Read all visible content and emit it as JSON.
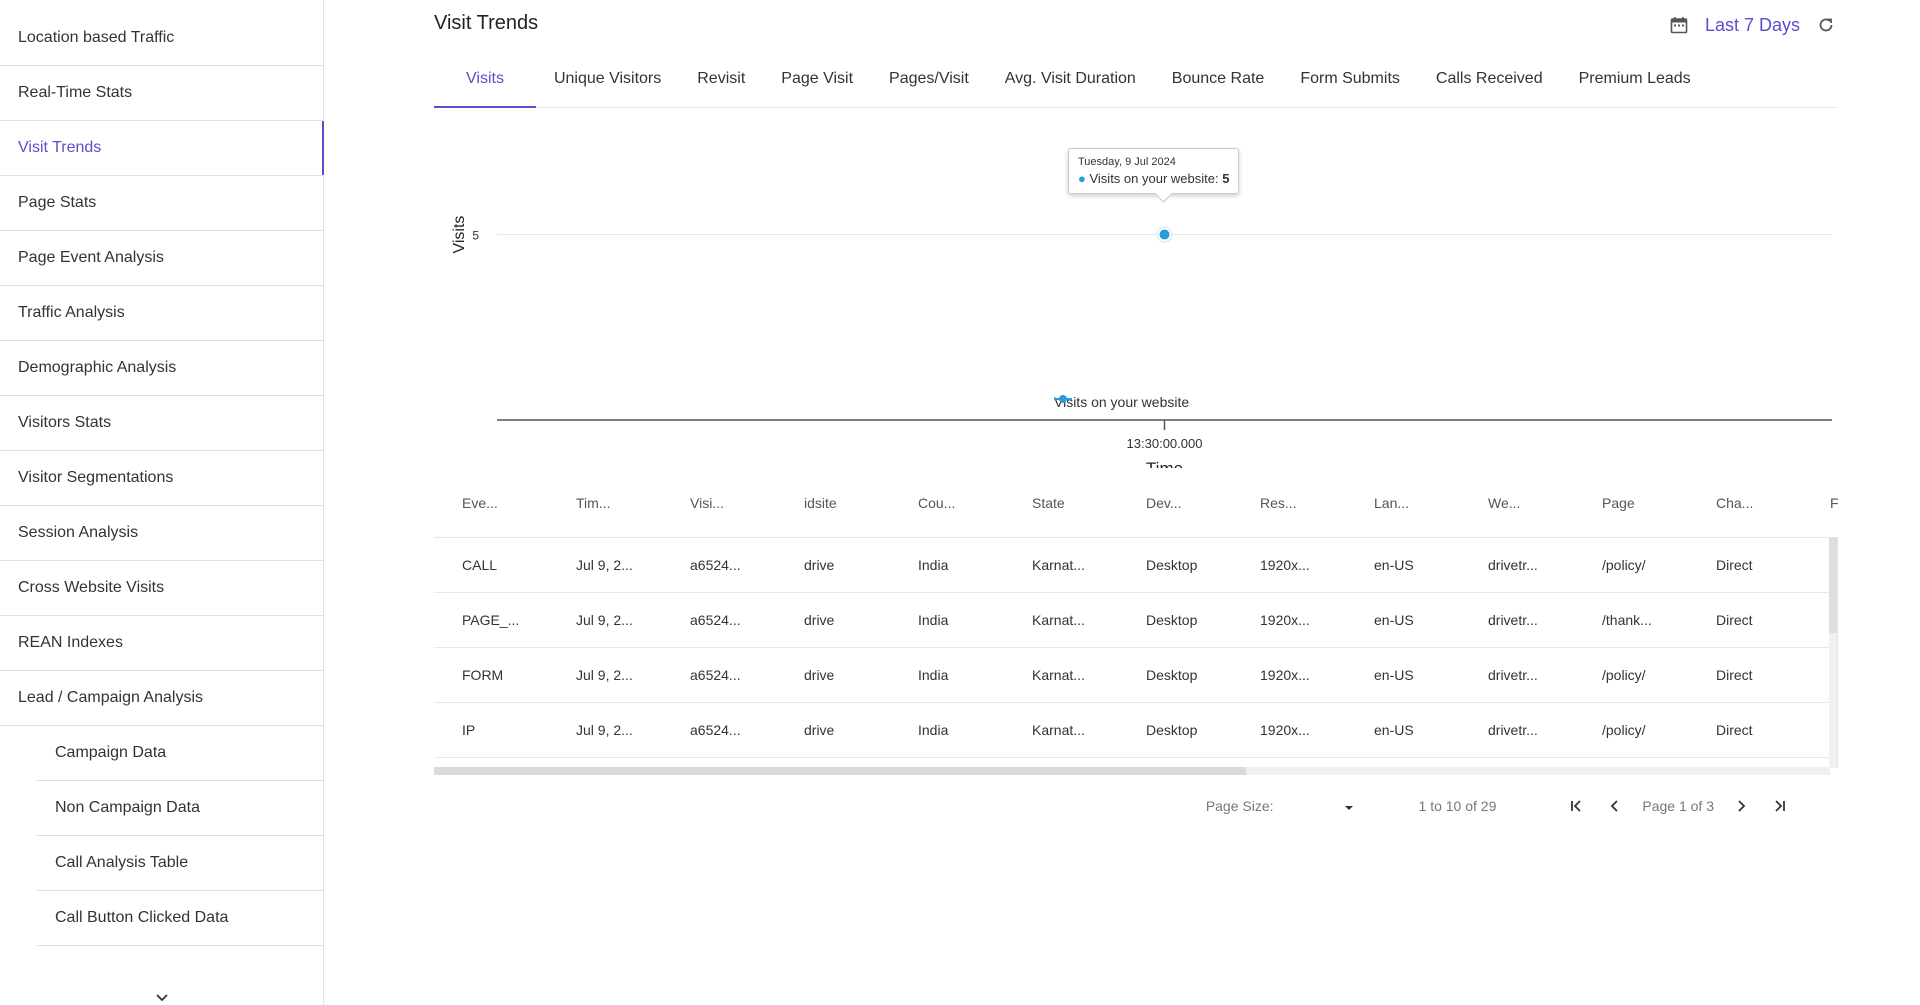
{
  "sidebar": {
    "items": [
      {
        "label": "Location based Traffic",
        "active": false,
        "sub": false
      },
      {
        "label": "Real-Time Stats",
        "active": false,
        "sub": false
      },
      {
        "label": "Visit Trends",
        "active": true,
        "sub": false
      },
      {
        "label": "Page Stats",
        "active": false,
        "sub": false
      },
      {
        "label": "Page Event Analysis",
        "active": false,
        "sub": false
      },
      {
        "label": "Traffic Analysis",
        "active": false,
        "sub": false
      },
      {
        "label": "Demographic Analysis",
        "active": false,
        "sub": false
      },
      {
        "label": "Visitors Stats",
        "active": false,
        "sub": false
      },
      {
        "label": "Visitor Segmentations",
        "active": false,
        "sub": false
      },
      {
        "label": "Session Analysis",
        "active": false,
        "sub": false
      },
      {
        "label": "Cross Website Visits",
        "active": false,
        "sub": false
      },
      {
        "label": "REAN Indexes",
        "active": false,
        "sub": false
      },
      {
        "label": "Lead / Campaign Analysis",
        "active": false,
        "sub": false
      },
      {
        "label": "Campaign Data",
        "active": false,
        "sub": true
      },
      {
        "label": "Non Campaign Data",
        "active": false,
        "sub": true
      },
      {
        "label": "Call Analysis Table",
        "active": false,
        "sub": true
      },
      {
        "label": "Call Button Clicked Data",
        "active": false,
        "sub": true
      }
    ]
  },
  "header": {
    "title": "Visit Trends",
    "date_range": "Last 7 Days"
  },
  "tabs": [
    {
      "label": "Visits",
      "active": true
    },
    {
      "label": "Unique Visitors",
      "active": false
    },
    {
      "label": "Revisit",
      "active": false
    },
    {
      "label": "Page Visit",
      "active": false
    },
    {
      "label": "Pages/Visit",
      "active": false
    },
    {
      "label": "Avg. Visit Duration",
      "active": false
    },
    {
      "label": "Bounce Rate",
      "active": false
    },
    {
      "label": "Form Submits",
      "active": false
    },
    {
      "label": "Calls Received",
      "active": false
    },
    {
      "label": "Premium Leads",
      "active": false
    }
  ],
  "chart_data": {
    "type": "line",
    "x": [
      "13:30:00.000"
    ],
    "series": [
      {
        "name": "Visits on your website",
        "values": [
          5
        ],
        "color": "#2b9bdc"
      }
    ],
    "xlabel": "Time",
    "ylabel": "Visits",
    "yticks": [
      5
    ],
    "legend": "bottom-center",
    "tooltip": {
      "date": "Tuesday, 9 Jul 2024",
      "series": "Visits on your website:",
      "value": "5"
    }
  },
  "table": {
    "columns": [
      "Eve...",
      "Tim...",
      "Visi...",
      "idsite",
      "Cou...",
      "State",
      "Dev...",
      "Res...",
      "Lan...",
      "We...",
      "Page",
      "Cha...",
      "F"
    ],
    "rows": [
      [
        "CALL",
        "Jul 9, 2...",
        "a6524...",
        "drive",
        "India",
        "Karnat...",
        "Desktop",
        "1920x...",
        "en-US",
        "drivetr...",
        "/policy/",
        "Direct"
      ],
      [
        "PAGE_...",
        "Jul 9, 2...",
        "a6524...",
        "drive",
        "India",
        "Karnat...",
        "Desktop",
        "1920x...",
        "en-US",
        "drivetr...",
        "/thank...",
        "Direct"
      ],
      [
        "FORM",
        "Jul 9, 2...",
        "a6524...",
        "drive",
        "India",
        "Karnat...",
        "Desktop",
        "1920x...",
        "en-US",
        "drivetr...",
        "/policy/",
        "Direct"
      ],
      [
        "IP",
        "Jul 9, 2...",
        "a6524...",
        "drive",
        "India",
        "Karnat...",
        "Desktop",
        "1920x...",
        "en-US",
        "drivetr...",
        "/policy/",
        "Direct"
      ]
    ]
  },
  "pager": {
    "page_size_label": "Page Size:",
    "summary": "1 to 10 of 29",
    "page_info": "Page 1 of 3"
  },
  "colors": {
    "accent": "#5a4fcf",
    "series": "#2b9bdc"
  }
}
